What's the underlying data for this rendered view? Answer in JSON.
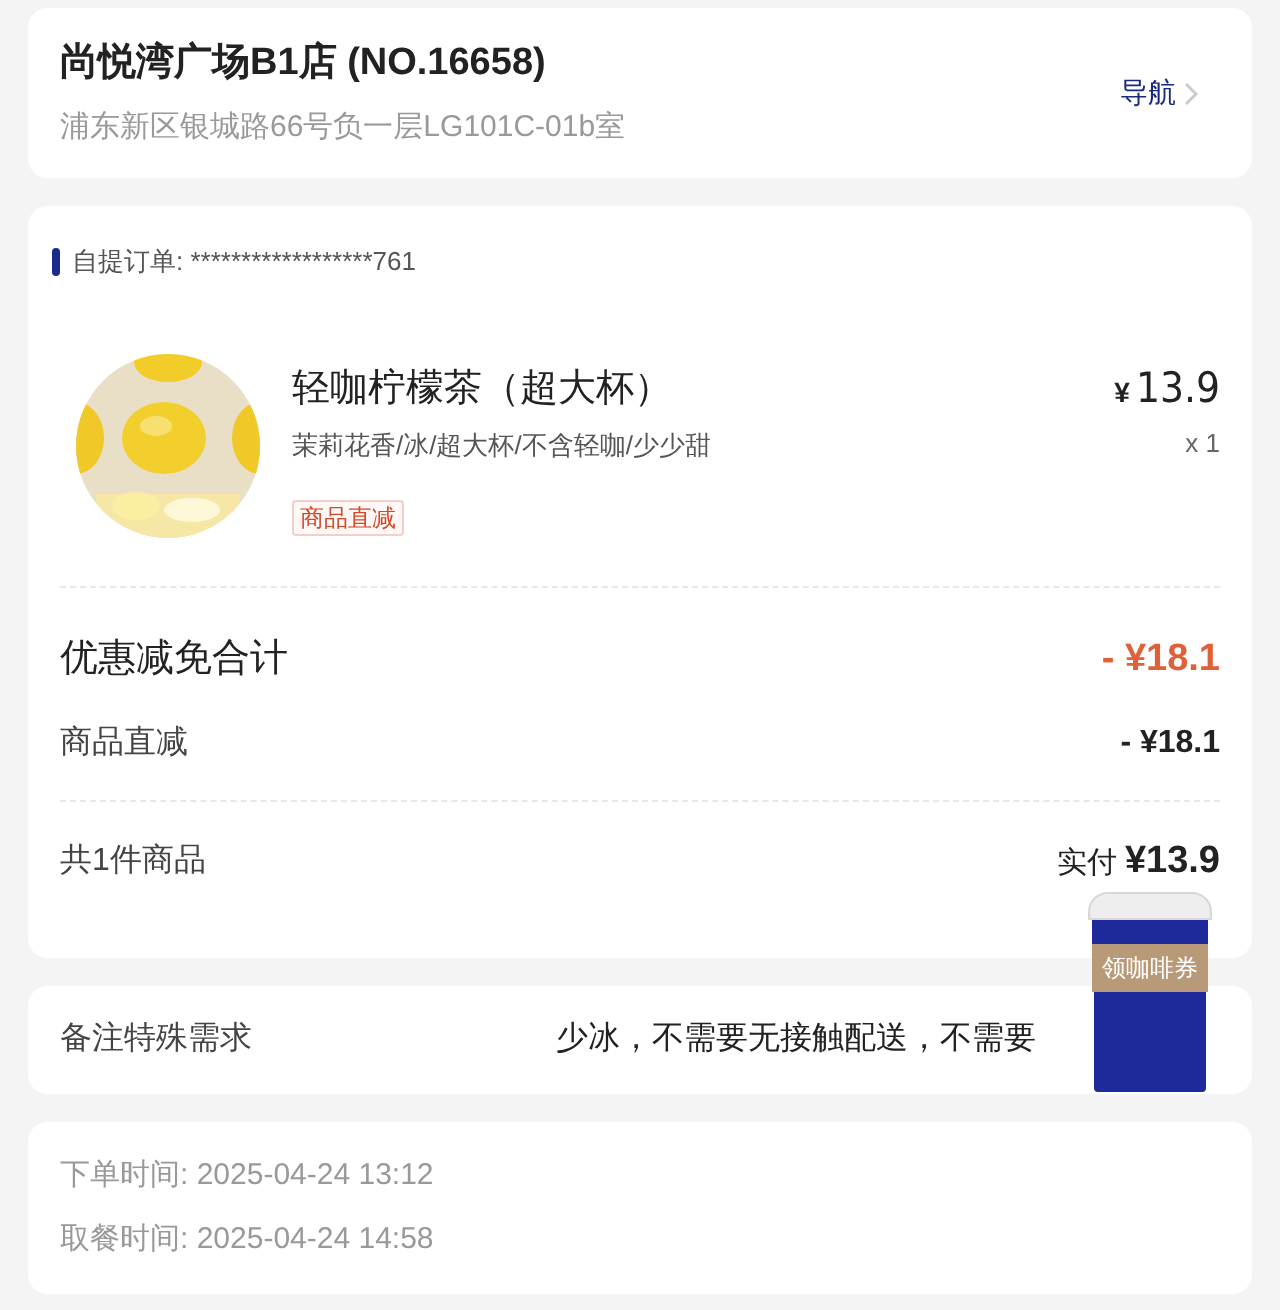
{
  "store": {
    "name": "尚悦湾广场B1店 (NO.16658)",
    "address": "浦东新区银城路66号负一层LG101C-01b室",
    "nav_label": "导航"
  },
  "order": {
    "label": "自提订单:",
    "number": "******************761",
    "items": [
      {
        "kind": "picture",
        "name": "轻咖柠檬茶（超大杯）",
        "options": "茉莉花香/冰/超大杯/不含轻咖/少少甜",
        "tag": "商品直减",
        "price": "13.9",
        "currency": "¥",
        "quantity": "x 1"
      }
    ],
    "discount_total": {
      "label": "优惠减免合计",
      "amount": "- ¥18.1"
    },
    "discounts": [
      {
        "label": "商品直减",
        "amount": "- ¥18.1"
      }
    ],
    "summary": {
      "count": "共1件商品",
      "paid_label": "实付",
      "paid": "¥13.9"
    }
  },
  "remark": {
    "label": "备注特殊需求",
    "value": "少冰，不需要无接触配送，不需要"
  },
  "times": [
    {
      "label": "下单时间:",
      "value": "2025-04-24 13:12"
    },
    {
      "label": "取餐时间:",
      "value": "2025-04-24 14:58"
    }
  ],
  "coupon_float": {
    "label": "领咖啡券"
  }
}
